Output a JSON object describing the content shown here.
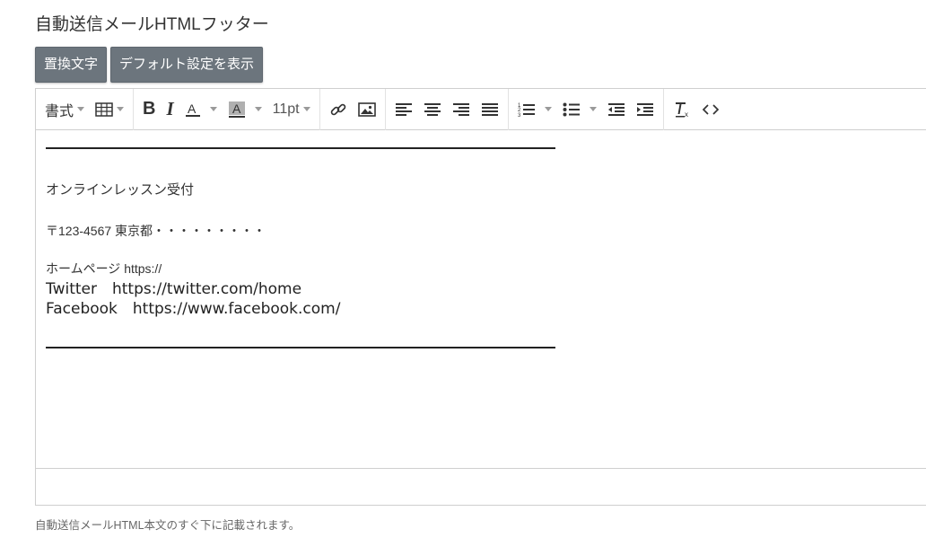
{
  "field": {
    "title": "自動送信メールHTMLフッター",
    "help_text": "自動送信メールHTML本文のすぐ下に記載されます。"
  },
  "buttons": {
    "replace_text": "置換文字",
    "show_default": "デフォルト設定を表示"
  },
  "toolbar": {
    "format_label": "書式",
    "font_size_label": "11pt",
    "icons": [
      "table-icon",
      "bold-icon",
      "italic-icon",
      "text-color-icon",
      "background-color-icon",
      "link-icon",
      "image-icon",
      "align-left-icon",
      "align-center-icon",
      "align-right-icon",
      "align-justify-icon",
      "numbered-list-icon",
      "bullet-list-icon",
      "outdent-icon",
      "indent-icon",
      "clear-format-icon",
      "source-code-icon"
    ]
  },
  "content": {
    "rule_top": "",
    "company": "オンラインレッスン受付",
    "address": "〒123-4567 東京都・・・・・・・・・",
    "homepage": "ホームページ  https://",
    "twitter": "Twitter　https://twitter.com/home",
    "facebook": "Facebook　https://www.facebook.com/"
  }
}
